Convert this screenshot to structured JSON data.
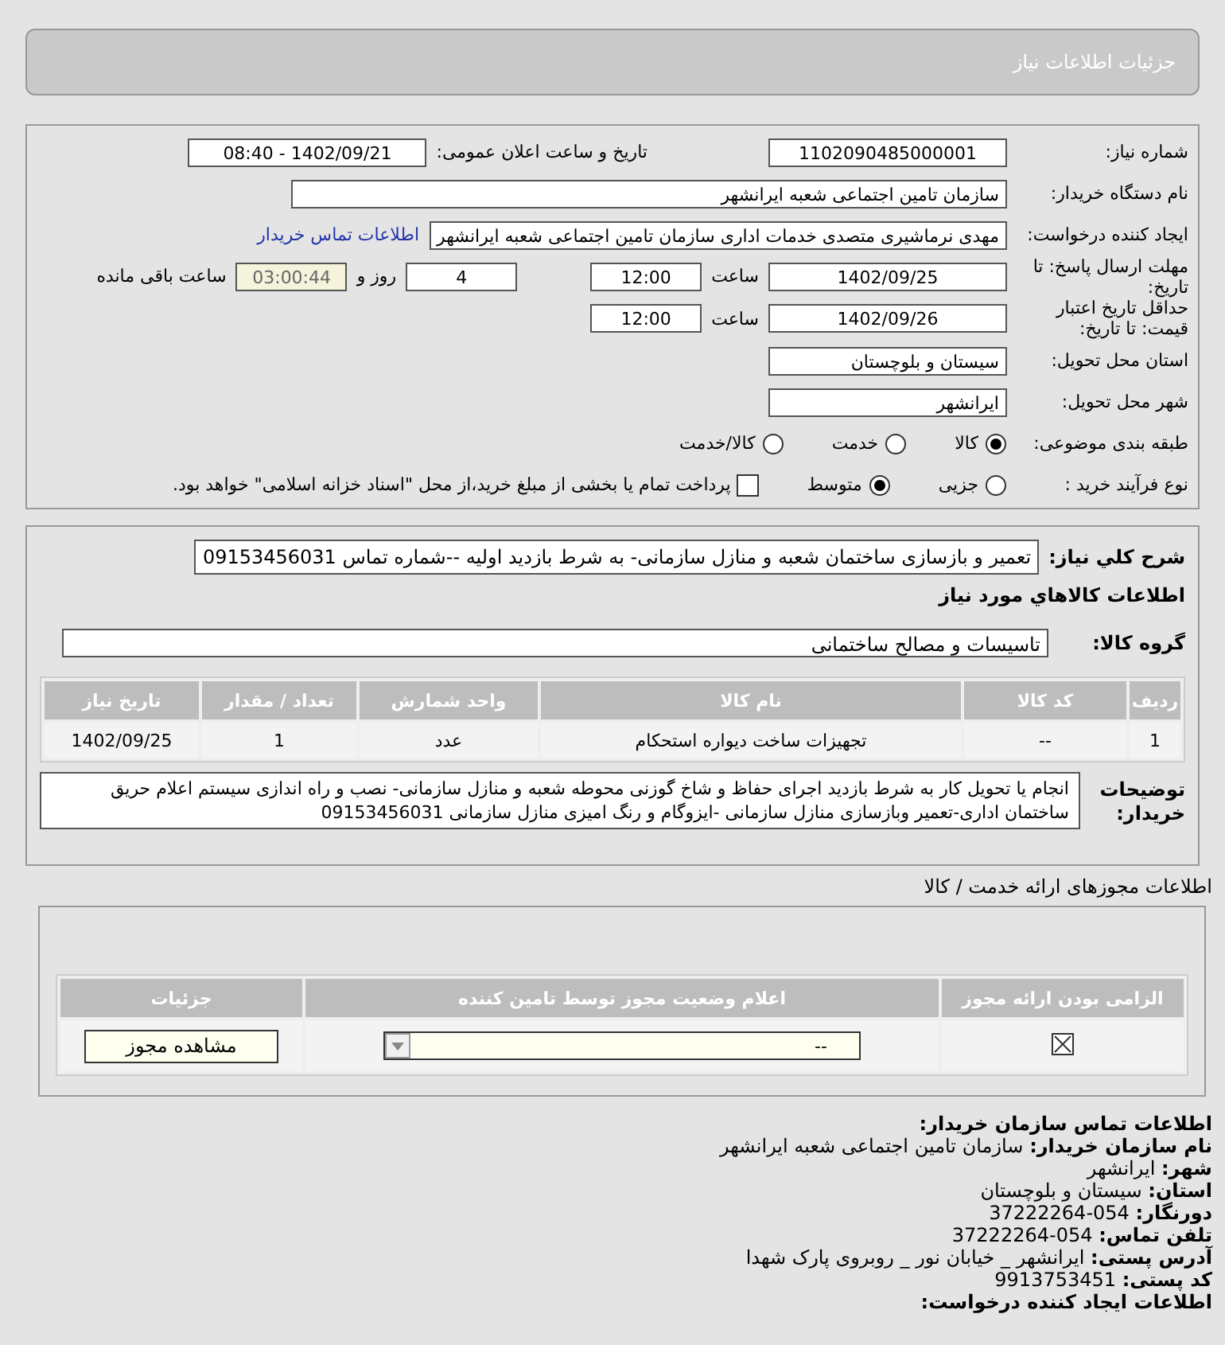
{
  "header": {
    "title": "جزئیات اطلاعات نیاز"
  },
  "form": {
    "need_number": {
      "label": "شماره نیاز:",
      "value": "1102090485000001"
    },
    "announce": {
      "label": "تاریخ و ساعت اعلان عمومی:",
      "value": "1402/09/21 - 08:40"
    },
    "buyer": {
      "label": "نام دستگاه خریدار:",
      "value": "سازمان تامین اجتماعی شعبه ایرانشهر"
    },
    "requester": {
      "label": "ایجاد کننده درخواست:",
      "value": "مهدی نرماشیری متصدی خدمات اداری سازمان تامین اجتماعی شعبه ایرانشهر",
      "link": "اطلاعات تماس خریدار"
    },
    "deadline": {
      "label": "مهلت ارسال پاسخ: تا تاریخ:",
      "date": "1402/09/25",
      "time_label": "ساعت",
      "time": "12:00",
      "days": "4",
      "days_label": "روز و",
      "remaining": "03:00:44",
      "remaining_label": "ساعت باقی مانده"
    },
    "validity": {
      "label": "حداقل تاریخ اعتبار قیمت: تا تاریخ:",
      "date": "1402/09/26",
      "time_label": "ساعت",
      "time": "12:00"
    },
    "province": {
      "label": "استان محل تحویل:",
      "value": "سیستان و بلوچستان"
    },
    "city": {
      "label": "شهر محل تحویل:",
      "value": "ایرانشهر"
    },
    "category": {
      "label": "طبقه بندی موضوعی:",
      "options": [
        {
          "label": "کالا",
          "selected": true
        },
        {
          "label": "خدمت",
          "selected": false
        },
        {
          "label": "کالا/خدمت",
          "selected": false
        }
      ]
    },
    "process": {
      "label": "نوع فرآیند خرید :",
      "options": [
        {
          "label": "جزیی",
          "selected": false
        },
        {
          "label": "متوسط",
          "selected": true
        }
      ],
      "payment": {
        "label": "پرداخت تمام یا بخشی از مبلغ خرید،از محل \"اسناد خزانه اسلامی\" خواهد بود.",
        "checked": false
      }
    }
  },
  "goods": {
    "description_label": "شرح كلي نياز:",
    "description": "تعمیر و بازسازی ساختمان شعبه و منازل سازمانی- به شرط بازدید اولیه --شماره تماس 09153456031",
    "title": "اطلاعات كالاهاي مورد نياز",
    "group_label": "گروه کالا:",
    "group_value": "تاسیسات و مصالح ساختمانی",
    "columns": [
      "ردیف",
      "کد کالا",
      "نام کالا",
      "واحد شمارش",
      "تعداد / مقدار",
      "تاریخ نیاز"
    ],
    "rows": [
      [
        "1",
        "--",
        "تجهیزات ساخت دیواره استحکام",
        "عدد",
        "1",
        "1402/09/25"
      ]
    ],
    "notes_label": "توضیحات خریدار:",
    "notes": "انجام یا تحویل کار به شرط بازدید اجرای حفاظ و شاخ گوزنی محوطه شعبه و منازل سازمانی- نصب و راه اندازی سیستم اعلام حریق ساختمان اداری-تعمیر وبازسازی منازل سازمانی -ایزوگام و رنگ امیزی منازل سازمانی 09153456031"
  },
  "licenses": {
    "title": "اطلاعات مجوزهای ارائه خدمت / کالا",
    "columns": [
      "الزامی بودن ارائه مجوز",
      "اعلام وضعیت مجوز توسط تامین کننده",
      "جزئیات"
    ],
    "rows": [
      {
        "required": true,
        "status": "--",
        "details_button": "مشاهده مجوز"
      }
    ]
  },
  "contact": {
    "title": "اطلاعات تماس سازمان خریدار:",
    "lines": [
      {
        "label": "نام سازمان خریدار:",
        "value": "سازمان تامین اجتماعی شعبه ایرانشهر"
      },
      {
        "label": "شهر:",
        "value": "ایرانشهر"
      },
      {
        "label": "استان:",
        "value": "سیستان و بلوچستان"
      },
      {
        "label": "دورنگار:",
        "value": "054-37222264"
      },
      {
        "label": "تلفن تماس:",
        "value": "054-37222264"
      },
      {
        "label": "آدرس پستی:",
        "value": "ایرانشهر _ خیابان نور _ روبروی پارک شهدا"
      },
      {
        "label": "کد پستی:",
        "value": "9913753451"
      }
    ],
    "next_title": "اطلاعات ایجاد کننده درخواست:"
  }
}
